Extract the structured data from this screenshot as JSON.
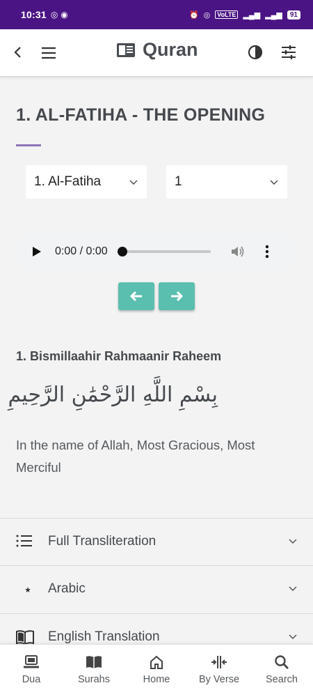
{
  "status_bar": {
    "time": "10:31",
    "network_badge": "VoLTE",
    "battery": "91"
  },
  "app_bar": {
    "title": "Quran"
  },
  "page": {
    "title": "1. AL-FATIHA - THE OPENING",
    "surah_select": {
      "value": "1. Al-Fatiha"
    },
    "verse_select": {
      "value": "1"
    },
    "audio": {
      "time": "0:00 / 0:00",
      "progress": 0
    },
    "verse": {
      "heading": "1. Bismillaahir Rahmaanir Raheem",
      "arabic": "بِسْمِ اللَّهِ الرَّحْمَٰنِ الرَّحِيمِ",
      "translation": "In the name of Allah, Most Gracious, Most Merciful"
    },
    "sections": [
      {
        "label": "Full Transliteration",
        "icon": "list-icon"
      },
      {
        "label": "Arabic",
        "icon": "crescent-star-icon"
      },
      {
        "label": "English Translation",
        "icon": "open-book-icon"
      }
    ]
  },
  "bottom_nav": [
    {
      "label": "Dua",
      "icon": "laptop-icon"
    },
    {
      "label": "Surahs",
      "icon": "book-icon"
    },
    {
      "label": "Home",
      "icon": "home-icon"
    },
    {
      "label": "By Verse",
      "icon": "split-icon"
    },
    {
      "label": "Search",
      "icon": "search-icon"
    }
  ],
  "colors": {
    "status_bar": "#4a1484",
    "accent_teal": "#5bbfb0",
    "title_rule": "#8f73b8"
  }
}
